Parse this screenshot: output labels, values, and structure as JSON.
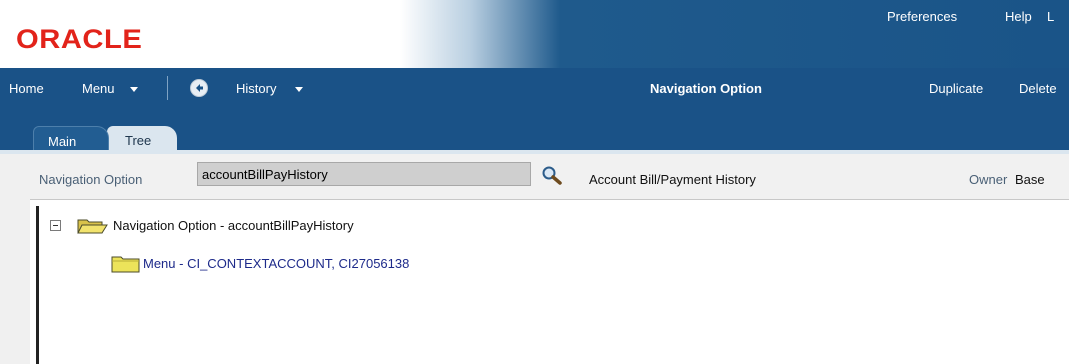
{
  "brand": {
    "logo_text": "ORACLE"
  },
  "top_links": {
    "preferences": "Preferences",
    "help": "Help",
    "logout": "L"
  },
  "nav": {
    "home": "Home",
    "menu": "Menu",
    "history": "History",
    "title": "Navigation Option",
    "duplicate": "Duplicate",
    "delete": "Delete"
  },
  "tabs": {
    "main": "Main",
    "tree": "Tree"
  },
  "record": {
    "field_label": "Navigation Option",
    "field_value": "accountBillPayHistory",
    "description": "Account Bill/Payment History",
    "owner_label": "Owner",
    "owner_value": "Base"
  },
  "tree": {
    "root": "Navigation Option - accountBillPayHistory",
    "child": "Menu - CI_CONTEXTACCOUNT, CI27056138"
  },
  "colors": {
    "brand_red": "#e2231a",
    "nav_blue": "#1a5287",
    "link_blue": "#1d2a8a"
  },
  "icons": {
    "back": "back-arrow-icon",
    "search": "search-icon",
    "folder_open": "folder-open-icon",
    "folder_closed": "folder-icon",
    "collapse": "collapse-icon"
  }
}
